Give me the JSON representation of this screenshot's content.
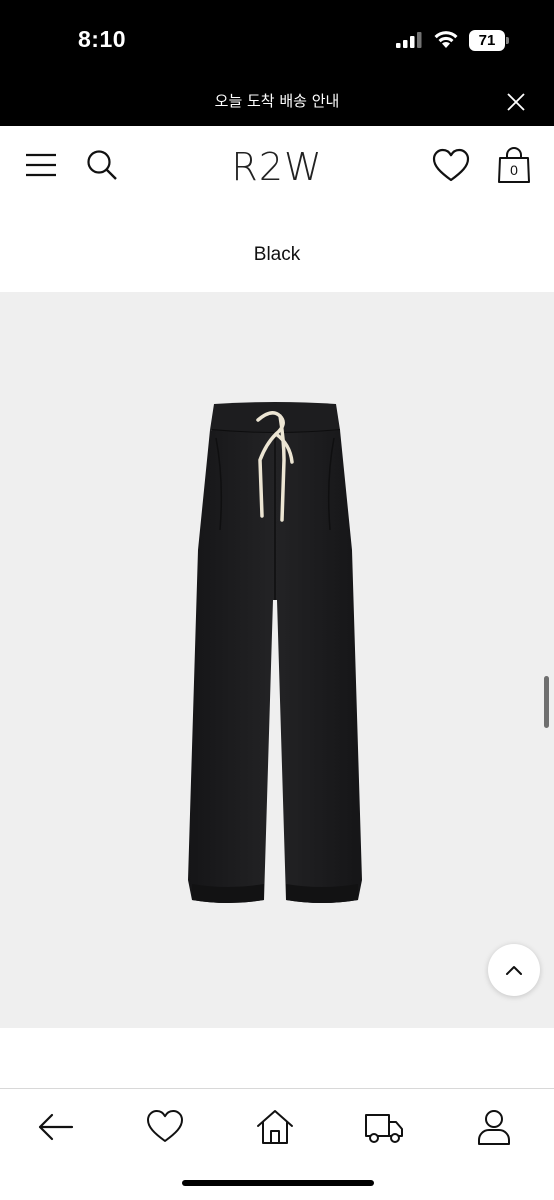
{
  "status_bar": {
    "time": "8:10",
    "battery": "71"
  },
  "banner": {
    "text": "오늘 도착 배송 안내",
    "close_icon": "close-icon"
  },
  "header": {
    "logo": "R2W",
    "menu_icon": "menu-icon",
    "search_icon": "search-icon",
    "wishlist_icon": "heart-icon",
    "bag_icon": "shopping-bag-icon",
    "bag_count": "0"
  },
  "product": {
    "color_name": "Black",
    "image_alt_icon": "pants-image",
    "colors": {
      "pants": "#1c1c1e",
      "drawstring": "#ece5d3",
      "background": "#efefef"
    }
  },
  "bottom_nav": {
    "items": [
      {
        "icon": "back-arrow-icon"
      },
      {
        "icon": "heart-icon"
      },
      {
        "icon": "home-icon"
      },
      {
        "icon": "delivery-truck-icon"
      },
      {
        "icon": "user-icon"
      }
    ]
  }
}
